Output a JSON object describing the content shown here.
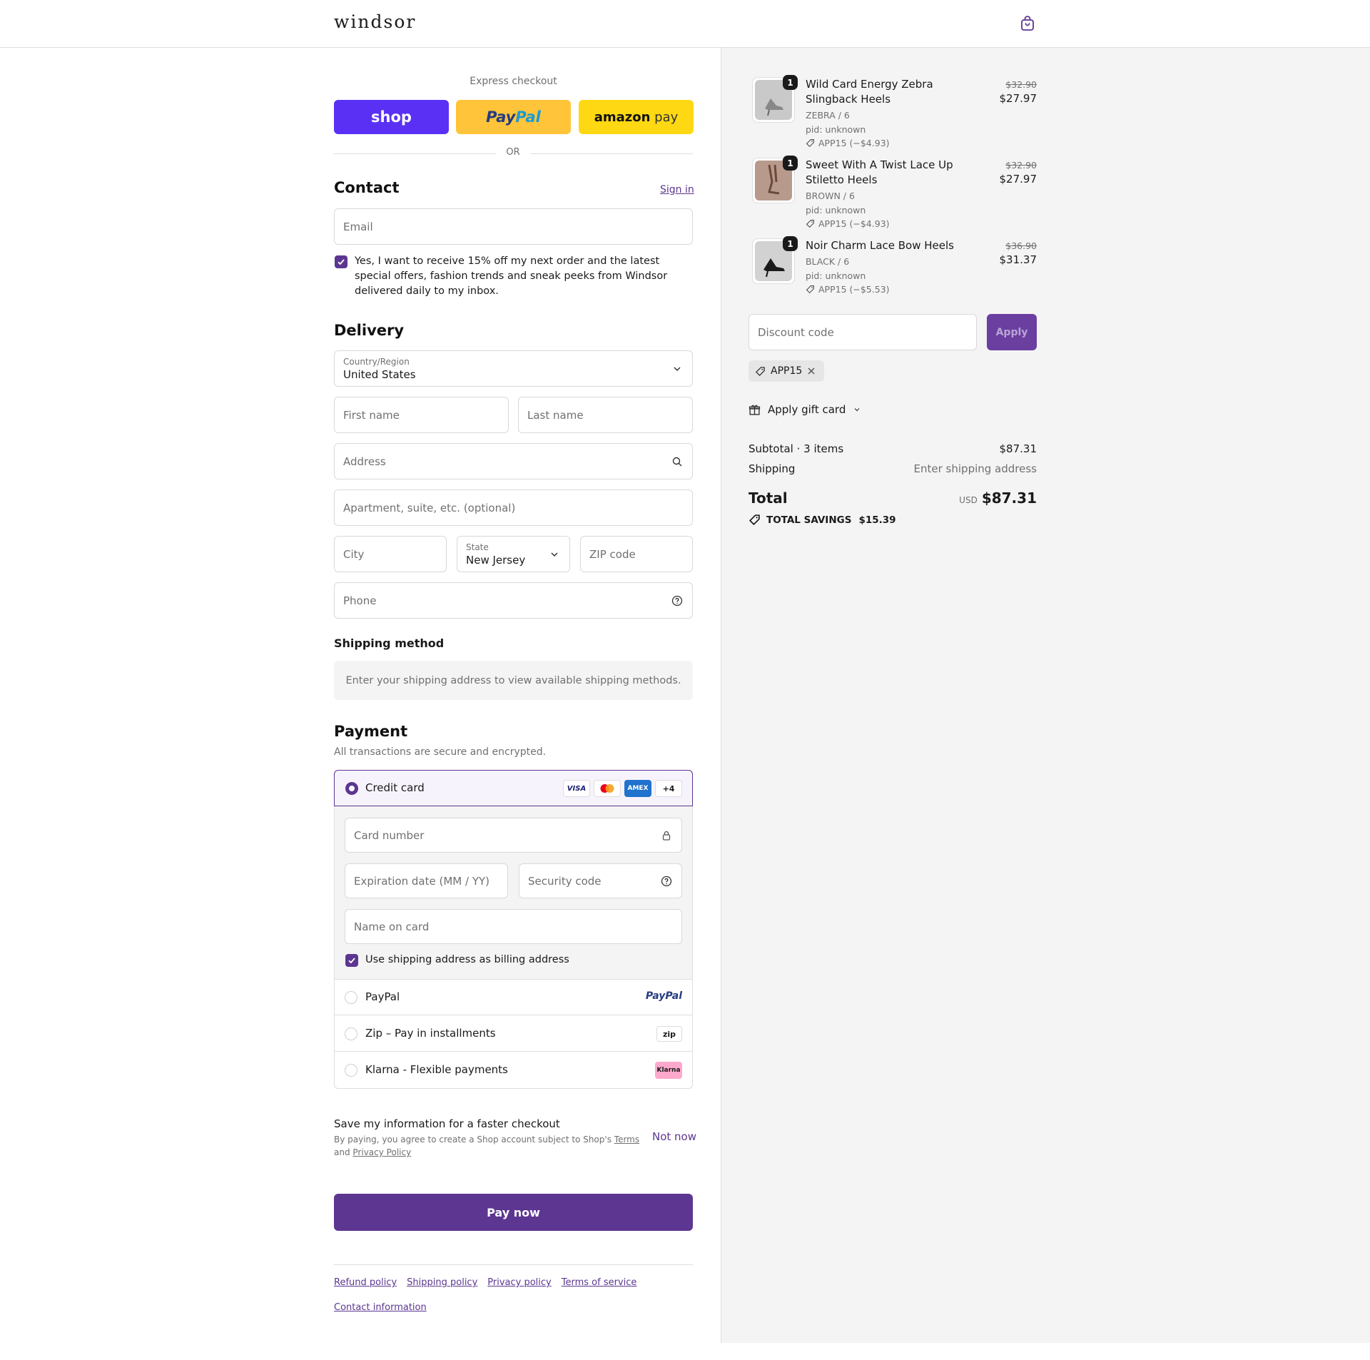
{
  "header": {
    "brand": "windsor",
    "cart_icon": "shopping-bag-icon"
  },
  "express": {
    "title": "Express checkout",
    "shop_label": "shop",
    "paypal_label_pay": "Pay",
    "paypal_label_pal": "Pal",
    "amazon_label": "amazon",
    "amazon_pay": "pay",
    "or": "OR",
    "colors": {
      "shop": "#5a31f4",
      "paypal": "#ffc439",
      "amazon": "#ffd814"
    }
  },
  "contact": {
    "title": "Contact",
    "sign_in": "Sign in",
    "email_placeholder": "Email",
    "newsletter_checked": true,
    "newsletter_text": "Yes, I want to receive 15% off my next order and the latest special offers, fashion trends and sneak peeks from Windsor delivered daily to my inbox."
  },
  "delivery": {
    "title": "Delivery",
    "country_label": "Country/Region",
    "country_value": "United States",
    "first_name": "First name",
    "last_name": "Last name",
    "address": "Address",
    "apartment": "Apartment, suite, etc. (optional)",
    "city": "City",
    "state_label": "State",
    "state_value": "New Jersey",
    "zip": "ZIP code",
    "phone": "Phone"
  },
  "shipping": {
    "title": "Shipping method",
    "notice": "Enter your shipping address to view available shipping methods."
  },
  "payment": {
    "title": "Payment",
    "subtitle": "All transactions are secure and encrypted.",
    "credit_card_label": "Credit card",
    "card_badges": [
      "VISA",
      "MC",
      "AMEX",
      "+4"
    ],
    "card_number": "Card number",
    "expiration": "Expiration date (MM / YY)",
    "security_code": "Security code",
    "name_on_card": "Name on card",
    "billing_same_checked": true,
    "billing_same": "Use shipping address as billing address",
    "options": [
      {
        "label": "PayPal",
        "logo": "PayPal"
      },
      {
        "label": "Zip – Pay in installments",
        "logo": "zip"
      },
      {
        "label": "Klarna - Flexible payments",
        "logo": "Klarna"
      }
    ]
  },
  "save_info": {
    "title": "Save my information for a faster checkout",
    "text_1": "By paying, you agree to create a Shop account subject to Shop's",
    "terms": "Terms",
    "and": "and",
    "privacy": "Privacy Policy",
    "not_now": "Not now"
  },
  "pay_now": "Pay now",
  "footer": {
    "links": [
      "Refund policy",
      "Shipping policy",
      "Privacy policy",
      "Terms of service"
    ],
    "contact": "Contact information"
  },
  "cart": {
    "items": [
      {
        "qty": "1",
        "name": "Wild Card Energy Zebra Slingback Heels",
        "variant": "ZEBRA / 6",
        "pid": "pid: unknown",
        "discount": "APP15 (−$4.93)",
        "old_price": "$32.90",
        "price": "$27.97"
      },
      {
        "qty": "1",
        "name": "Sweet With A Twist Lace Up Stiletto Heels",
        "variant": "BROWN / 6",
        "pid": "pid: unknown",
        "discount": "APP15 (−$4.93)",
        "old_price": "$32.90",
        "price": "$27.97"
      },
      {
        "qty": "1",
        "name": "Noir Charm Lace Bow Heels",
        "variant": "BLACK / 6",
        "pid": "pid: unknown",
        "discount": "APP15 (−$5.53)",
        "old_price": "$36.90",
        "price": "$31.37"
      }
    ],
    "discount_placeholder": "Discount code",
    "apply": "Apply",
    "applied_code": "APP15",
    "gift_card": "Apply gift card",
    "subtotal_label": "Subtotal · 3 items",
    "subtotal_value": "$87.31",
    "shipping_label": "Shipping",
    "shipping_value": "Enter shipping address",
    "total_label": "Total",
    "currency": "USD",
    "total_value": "$87.31",
    "savings_label": "TOTAL SAVINGS",
    "savings_value": "$15.39"
  },
  "colors": {
    "accent": "#5c3690",
    "sidebar_bg": "#f4f4f4",
    "border": "#d9d9d9"
  }
}
